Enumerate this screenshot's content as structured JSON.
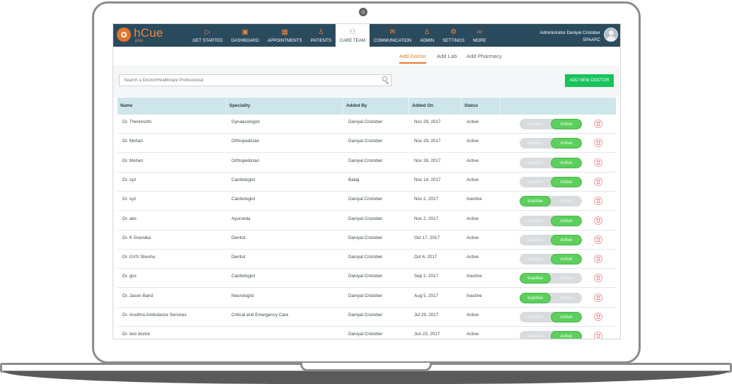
{
  "app": {
    "logo_text": "hCue",
    "logo_sub": "plus"
  },
  "nav": [
    {
      "label": "GET STARTED",
      "icon": "play-icon",
      "glyph": "▷"
    },
    {
      "label": "DASHBOARD",
      "icon": "presentation-icon",
      "glyph": "▣"
    },
    {
      "label": "APPOINTMENTS",
      "icon": "calendar-icon",
      "glyph": "▦"
    },
    {
      "label": "PATIENTS",
      "icon": "user-icon",
      "glyph": "♙"
    },
    {
      "label": "CARE TEAM",
      "icon": "team-icon",
      "glyph": "⚇"
    },
    {
      "label": "COMMUNICATION",
      "icon": "chat-icon",
      "glyph": "✉"
    },
    {
      "label": "ADMIN",
      "icon": "admin-icon",
      "glyph": "♙"
    },
    {
      "label": "SETTINGS",
      "icon": "gear-icon",
      "glyph": "⚙"
    },
    {
      "label": "MORE",
      "icon": "more-icon",
      "glyph": "∞"
    }
  ],
  "user": {
    "name": "Administrator Daniyal Cristober",
    "org": "SPAARC"
  },
  "subtabs": [
    "Add Doctor",
    "Add Lab",
    "Add Pharmacy"
  ],
  "search": {
    "placeholder": "Search a Doctor/Healthcare Professional"
  },
  "add_button": "ADD NEW DOCTOR",
  "table": {
    "headers": [
      "Name",
      "Speciality",
      "Added By",
      "Added On",
      "Status"
    ],
    "toggle_labels": {
      "inactive": "Inactive",
      "active": "Active"
    },
    "rows": [
      {
        "name": "Dr. Thenmozhi",
        "speciality": "Gynaecologist",
        "added_by": "Daniyal Cristober",
        "added_on": "Nov 29, 2017",
        "status": "Active"
      },
      {
        "name": "Dr. Mohan",
        "speciality": "Orthopedician",
        "added_by": "Daniyal Cristober",
        "added_on": "Nov 29, 2017",
        "status": "Active"
      },
      {
        "name": "Dr. Mohan",
        "speciality": "Orthopedician",
        "added_by": "Daniyal Cristober",
        "added_on": "Nov 28, 2017",
        "status": "Active"
      },
      {
        "name": "Dr. xyz",
        "speciality": "Cardiologist",
        "added_by": "Balaji",
        "added_on": "Nov 14, 2017",
        "status": "Active"
      },
      {
        "name": "Dr. xyz",
        "speciality": "Cardiologist",
        "added_by": "Daniyal Cristober",
        "added_on": "Nov 2, 2017",
        "status": "Inactive"
      },
      {
        "name": "Dr. abc",
        "speciality": "Ayurveda",
        "added_by": "Daniyal Cristober",
        "added_on": "Nov 2, 2017",
        "status": "Active"
      },
      {
        "name": "Dr. K Gowsika",
        "speciality": "Dentist",
        "added_by": "Daniyal Cristober",
        "added_on": "Oct 17, 2017",
        "status": "Active"
      },
      {
        "name": "Dr. GVS Sheshu",
        "speciality": "Dentist",
        "added_by": "Daniyal Cristober",
        "added_on": "Oct 6, 2017",
        "status": "Active"
      },
      {
        "name": "Dr. gvs",
        "speciality": "Cardiologist",
        "added_by": "Daniyal Cristober",
        "added_on": "Sep 2, 2017",
        "status": "Inactive"
      },
      {
        "name": "Dr. Jason Baird",
        "speciality": "Neurologist",
        "added_by": "Daniyal Cristober",
        "added_on": "Aug 5, 2017",
        "status": "Inactive"
      },
      {
        "name": "Dr. Arudhra Ambulance Services",
        "speciality": "Critical and Emergency Care",
        "added_by": "Daniyal Cristober",
        "added_on": "Jul 29, 2017",
        "status": "Active"
      },
      {
        "name": "Dr. test doctor",
        "speciality": "",
        "added_by": "Daniyal Cristober",
        "added_on": "Jun 23, 2017",
        "status": "Active"
      }
    ]
  },
  "colors": {
    "topbar": "#2a4a5e",
    "accent": "#e67a2e",
    "add_button": "#19c35b",
    "toggle_on": "#5ccf5c",
    "table_header": "#cce6ea"
  }
}
